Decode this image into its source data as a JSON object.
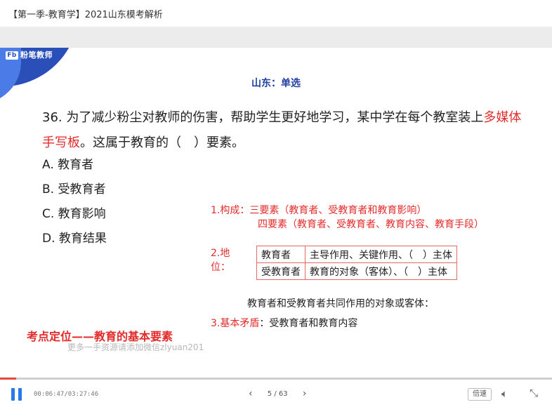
{
  "window": {
    "title": "【第一季-教育学】2021山东模考解析"
  },
  "slide": {
    "logo": "粉笔教师",
    "logo_mark": "Fb",
    "subject": "山东：单选",
    "question_part1": "36. 为了减少粉尘对教师的伤害，帮助学生更好地学习，某中学在每个教室装上",
    "question_highlight": "多媒体手写板",
    "question_part2": "。这属于教育的（　）要素。",
    "options": [
      "A. 教育者",
      "B. 受教育者",
      "C. 教育影响",
      "D. 教育结果"
    ],
    "notes": {
      "n1_label": "1.构成：",
      "n1_three_label": "三要素",
      "n1_three_text": "（教育者、受教育者和教育影响）",
      "n1_four_label": "四要素",
      "n1_four_text": "（教育者、受教育者、教育内容、教育手段）",
      "n2_label": "2.地位：",
      "table": [
        [
          "教育者",
          "主导作用、关键作用、（　）主体"
        ],
        [
          "受教育者",
          "教育的对象（客体）、（　）主体"
        ]
      ],
      "n2_extra": "教育者和受教育者共同作用的对象或客体：",
      "n3_label": "3.基本矛盾",
      "n3_text": "：受教育者和教育内容"
    },
    "focus": "考点定位——教育的基本要素",
    "watermark": "更多一手资源请添加微信zlyuan201"
  },
  "player": {
    "progress": 0.029,
    "time": "00:06:47/03:27:46",
    "prev": "‹",
    "page": "5 / 63",
    "next": "›",
    "speed": "倍速",
    "accent": "#2a79e8",
    "progress_color": "#e84a3a"
  }
}
